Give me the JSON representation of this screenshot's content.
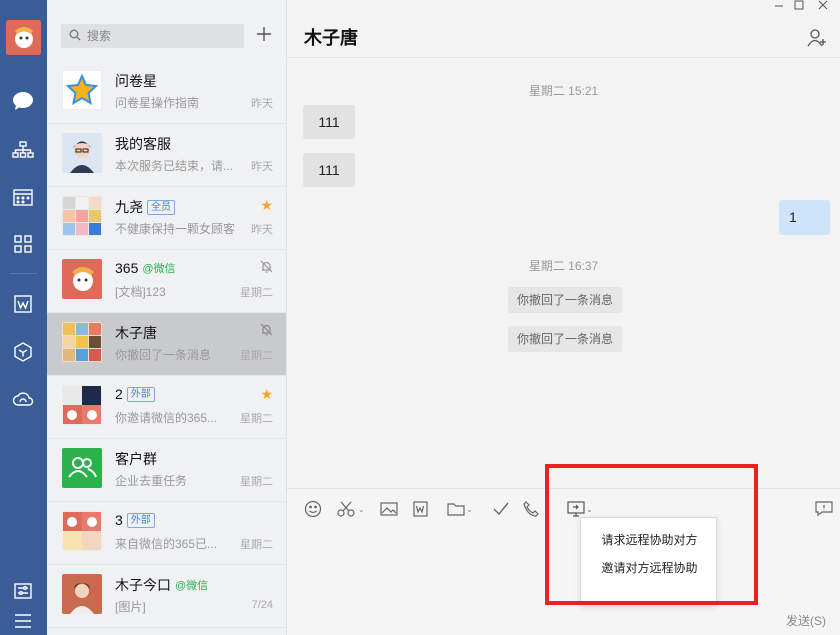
{
  "search": {
    "placeholder": "搜索"
  },
  "conversations": [
    {
      "name": "问卷星",
      "preview": "问卷星操作指南",
      "time": "昨天"
    },
    {
      "name": "我的客服",
      "preview": "本次服务已结束，请...",
      "time": "昨天"
    },
    {
      "name": "九尧",
      "tag": "全员",
      "preview": "不健康保持一颗女顾客",
      "time": "昨天",
      "starred": true
    },
    {
      "name": "365",
      "wechat": "@微信",
      "preview": "[文档]123",
      "time": "星期二",
      "muted": true
    },
    {
      "name": "木子唐",
      "preview": "你撤回了一条消息",
      "time": "星期二",
      "muted": true,
      "active": true
    },
    {
      "name": "2",
      "tag": "外部",
      "preview": "你邀请微信的365...",
      "time": "星期二",
      "starred": true
    },
    {
      "name": "客户群",
      "preview": "企业去重任务",
      "time": "星期二"
    },
    {
      "name": "3",
      "tag": "外部",
      "preview": "来自微信的365已...",
      "time": "星期二"
    },
    {
      "name": "木子今口",
      "wechat": "@微信",
      "preview": "[图片]",
      "time": "7/24"
    }
  ],
  "chat": {
    "title": "木子唐",
    "timestamps": [
      "星期二 15:21",
      "星期二 16:37"
    ],
    "messages_left": [
      "111",
      "111"
    ],
    "message_right": "1",
    "system_messages": [
      "你撤回了一条消息",
      "你撤回了一条消息"
    ],
    "send_label": "发送(S)"
  },
  "remote_menu": {
    "items": [
      "请求远程协助对方",
      "邀请对方远程协助"
    ]
  },
  "colors": {
    "rail": "#3b5d97",
    "accent_highlight": "#e8221f",
    "my_bubble": "#cde4fb"
  }
}
